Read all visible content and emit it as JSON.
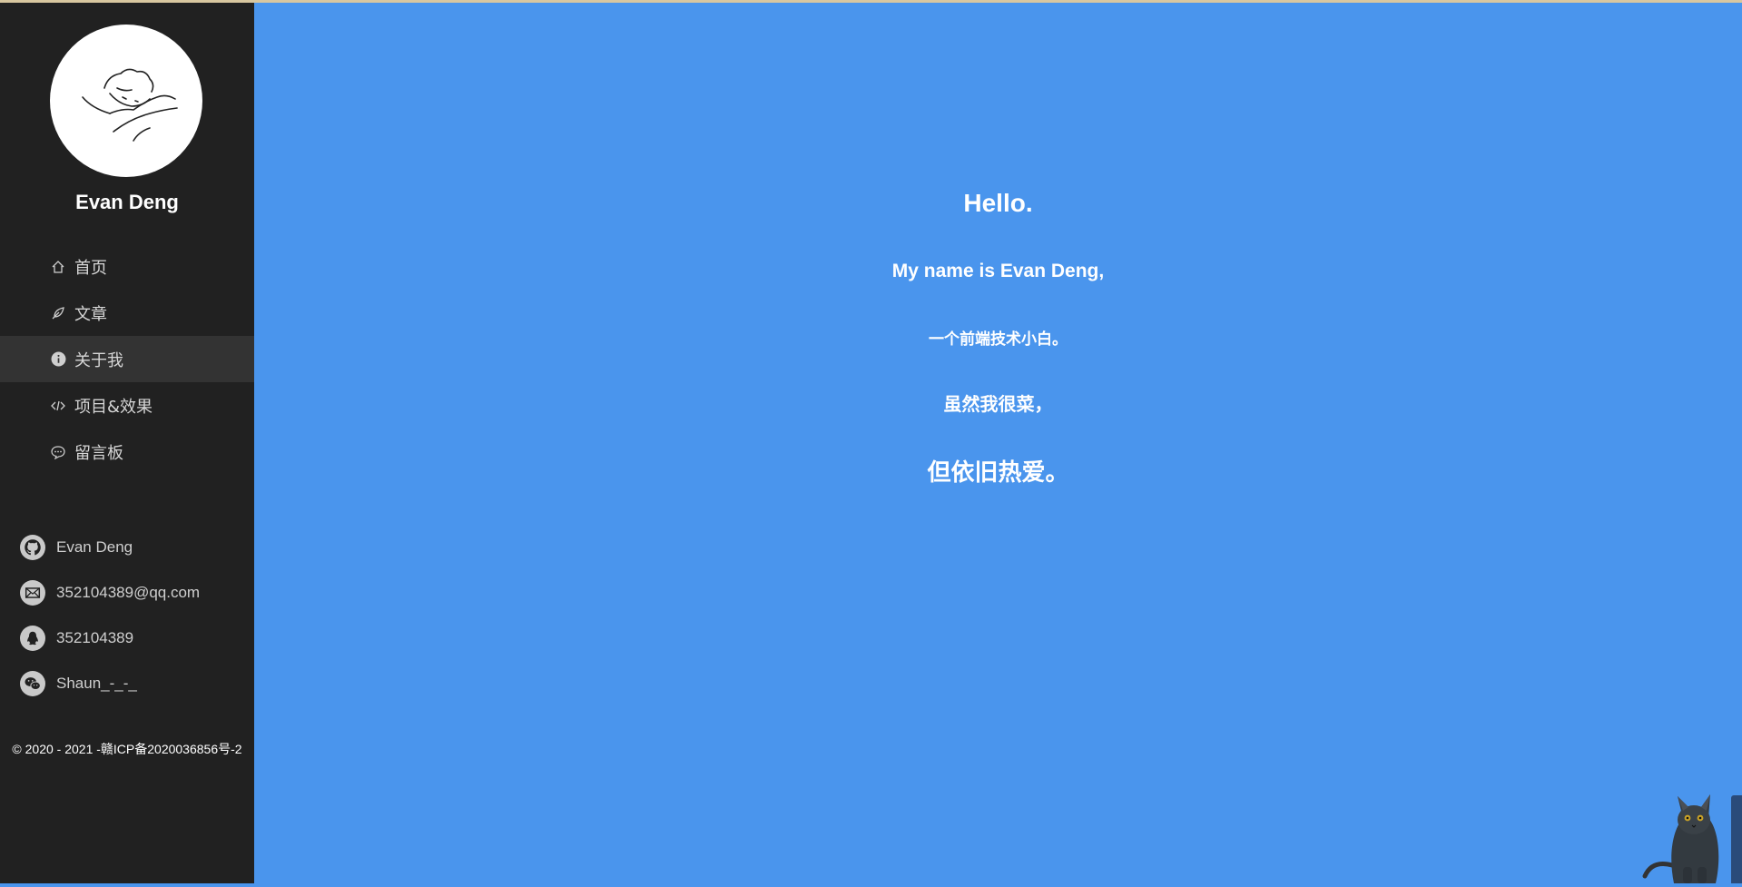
{
  "profile": {
    "name": "Evan Deng"
  },
  "nav": {
    "items": [
      {
        "label": "首页",
        "icon": "home-icon"
      },
      {
        "label": "文章",
        "icon": "feather-icon"
      },
      {
        "label": "关于我",
        "icon": "info-icon",
        "active": true
      },
      {
        "label": "项目&效果",
        "icon": "code-icon"
      },
      {
        "label": "留言板",
        "icon": "chat-icon"
      }
    ]
  },
  "contacts": {
    "items": [
      {
        "label": "Evan Deng",
        "icon": "github-icon"
      },
      {
        "label": "352104389@qq.com",
        "icon": "mail-icon"
      },
      {
        "label": "352104389",
        "icon": "qq-icon"
      },
      {
        "label": "Shaun_-_-_",
        "icon": "wechat-icon"
      }
    ]
  },
  "footer": {
    "copyright": "© 2020 - 2021 -赣ICP备2020036856号-2"
  },
  "main": {
    "line1": "Hello.",
    "line2": "My name is Evan Deng,",
    "line3": "一个前端技术小白。",
    "line4": "虽然我很菜，",
    "line5": "但依旧热爱。"
  },
  "colors": {
    "sidebar_bg": "#212121",
    "main_bg": "#4a95ed",
    "active_item_bg": "#333333"
  }
}
